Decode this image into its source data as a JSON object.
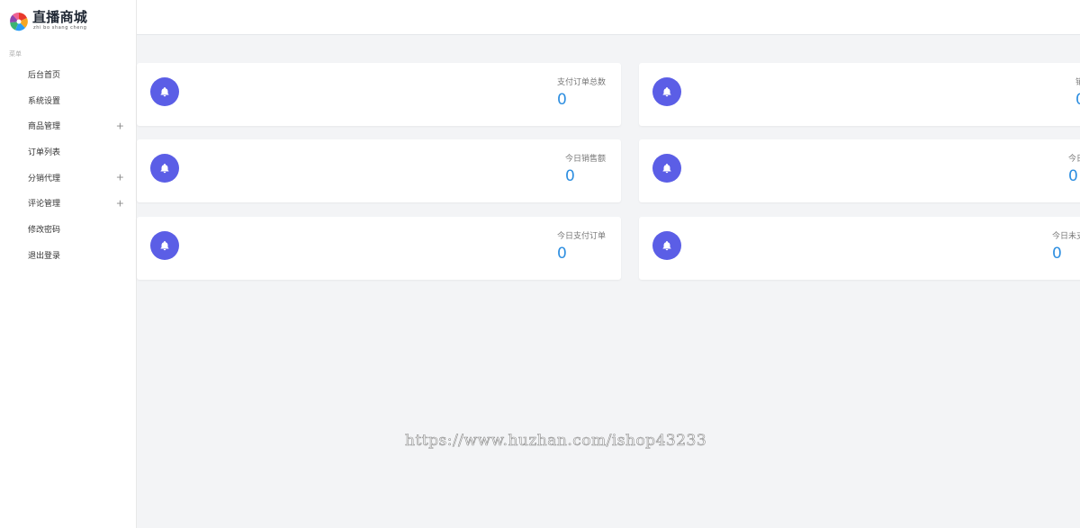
{
  "brand": {
    "title": "直播商城",
    "subtitle": "zhi bo shang cheng"
  },
  "sidebar": {
    "section_label": "菜单",
    "items": [
      {
        "label": "后台首页",
        "expandable": false
      },
      {
        "label": "系统设置",
        "expandable": false
      },
      {
        "label": "商品管理",
        "expandable": true,
        "toggle": "+"
      },
      {
        "label": "订单列表",
        "expandable": false
      },
      {
        "label": "分销代理",
        "expandable": true,
        "toggle": "+"
      },
      {
        "label": "评论管理",
        "expandable": true,
        "toggle": "+"
      },
      {
        "label": "修改密码",
        "expandable": false
      },
      {
        "label": "退出登录",
        "expandable": false
      }
    ]
  },
  "stats": {
    "left": [
      {
        "title": "支付订单总数",
        "value": "0",
        "icon": "bell-icon"
      },
      {
        "title": "今日销售额",
        "value": "0",
        "icon": "bell-icon"
      },
      {
        "title": "今日支付订单",
        "value": "0",
        "icon": "bell-icon"
      }
    ],
    "right": [
      {
        "title": "销",
        "value": "0",
        "icon": "bell-icon"
      },
      {
        "title": "今日",
        "value": "0",
        "icon": "bell-icon"
      },
      {
        "title": "今日未支",
        "value": "0",
        "icon": "bell-icon"
      }
    ]
  },
  "watermark": "https://www.huzhan.com/ishop43233",
  "colors": {
    "accent_icon_bg": "#5b5ee6",
    "value_text": "#2d8ee0",
    "page_bg": "#f3f4f6"
  }
}
